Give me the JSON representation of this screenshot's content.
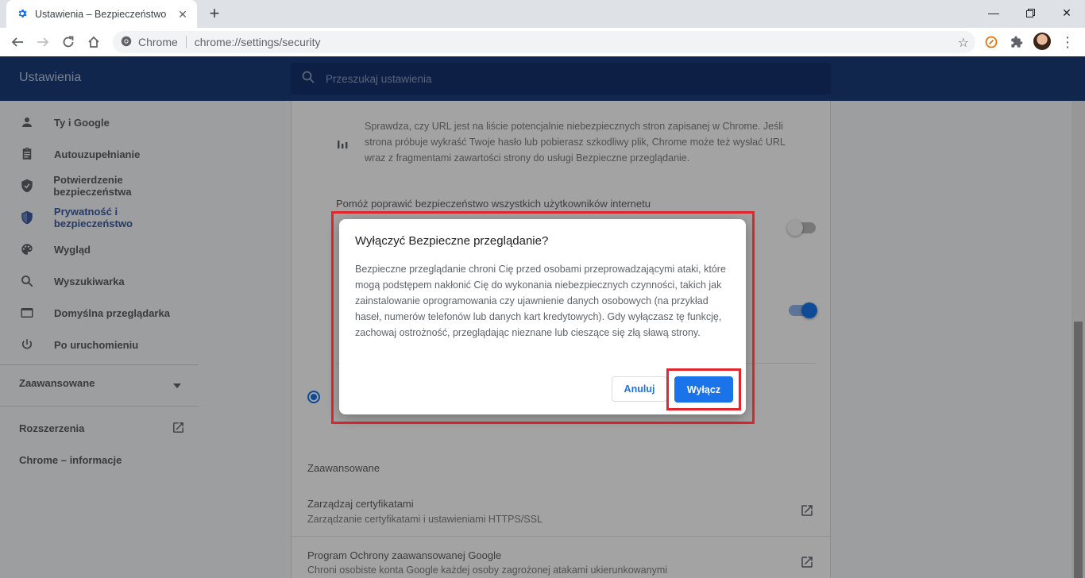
{
  "browser": {
    "tab_title": "Ustawienia – Bezpieczeństwo",
    "site_label": "Chrome",
    "url": "chrome://settings/security"
  },
  "header": {
    "title": "Ustawienia",
    "search_placeholder": "Przeszukaj ustawienia"
  },
  "sidebar": {
    "items": [
      {
        "label": "Ty i Google",
        "icon": "person-icon"
      },
      {
        "label": "Autouzupełnianie",
        "icon": "clipboard-icon"
      },
      {
        "label": "Potwierdzenie bezpieczeństwa",
        "icon": "shield-check-icon"
      },
      {
        "label": "Prywatność i bezpieczeństwo",
        "icon": "shield-icon"
      },
      {
        "label": "Wygląd",
        "icon": "palette-icon"
      },
      {
        "label": "Wyszukiwarka",
        "icon": "search-icon"
      },
      {
        "label": "Domyślna przeglądarka",
        "icon": "browser-icon"
      },
      {
        "label": "Po uruchomieniu",
        "icon": "power-icon"
      }
    ],
    "advanced_label": "Zaawansowane",
    "extensions_label": "Rozszerzenia",
    "about_label": "Chrome – informacje",
    "active_index": 3
  },
  "main": {
    "info_text_line1": "Sprawdza, czy URL jest na liście potencjalnie niebezpiecznych stron zapisanej w Chrome. Jeśli",
    "info_text_line2": "strona próbuje wykraść Twoje hasło lub pobierasz szkodliwy plik, Chrome może też wysłać URL",
    "info_text_line3": "wraz z fragmentami zawartości strony do usługi Bezpieczne przeglądanie.",
    "help_heading": "Pomóż poprawić bezpieczeństwo wszystkich użytkowników internetu",
    "help_toggle_on": false,
    "second_toggle_on": true,
    "advanced_section": "Zaawansowane",
    "cert_title": "Zarządzaj certyfikatami",
    "cert_desc": "Zarządzanie certyfikatami i ustawieniami HTTPS/SSL",
    "program_title": "Program Ochrony zaawansowanej Google",
    "program_desc": "Chroni osobiste konta Google każdej osoby zagrożonej atakami ukierunkowanymi"
  },
  "dialog": {
    "title": "Wyłączyć Bezpieczne przeglądanie?",
    "body": "Bezpieczne przeglądanie chroni Cię przed osobami przeprowadzającymi ataki, które mogą podstępem nakłonić Cię do wykonania niebezpiecznych czynności, takich jak zainstalowanie oprogramowania czy ujawnienie danych osobowych (na przykład haseł, numerów telefonów lub danych kart kredytowych). Gdy wyłączasz tę funkcję, zachowaj ostrożność, przeglądając nieznane lub cieszące się złą sławą strony.",
    "cancel_label": "Anuluj",
    "confirm_label": "Wyłącz"
  },
  "colors": {
    "accent": "#1a73e8",
    "header_bg": "#1a3b76",
    "highlight": "#e1262c"
  }
}
